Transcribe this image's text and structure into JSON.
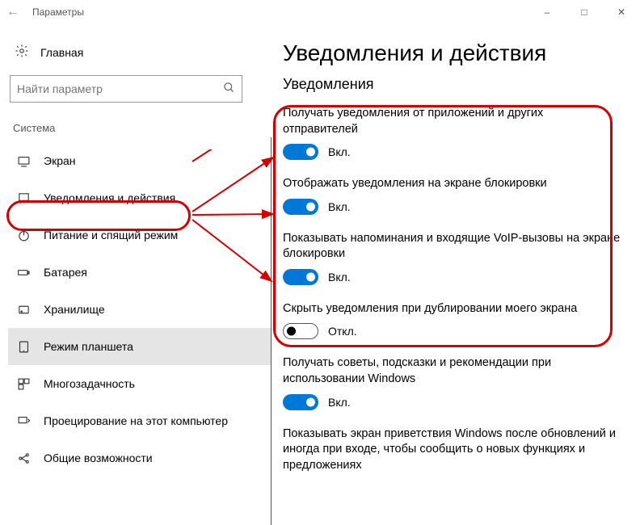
{
  "window": {
    "title": "Параметры"
  },
  "sidebar": {
    "home": "Главная",
    "search_placeholder": "Найти параметр",
    "section": "Система",
    "items": [
      {
        "label": "Экран"
      },
      {
        "label": "Уведомления и действия"
      },
      {
        "label": "Питание и спящий режим"
      },
      {
        "label": "Батарея"
      },
      {
        "label": "Хранилище"
      },
      {
        "label": "Режим планшета"
      },
      {
        "label": "Многозадачность"
      },
      {
        "label": "Проецирование на этот компьютер"
      },
      {
        "label": "Общие возможности"
      }
    ]
  },
  "page": {
    "heading": "Уведомления и действия",
    "section": "Уведомления",
    "toggles": [
      {
        "label": "Получать уведомления от приложений и других отправителей",
        "state": "Вкл.",
        "on": true
      },
      {
        "label": "Отображать уведомления на экране блокировки",
        "state": "Вкл.",
        "on": true
      },
      {
        "label": "Показывать напоминания и входящие VoIP-вызовы на экране блокировки",
        "state": "Вкл.",
        "on": true
      },
      {
        "label": "Скрыть уведомления при дублировании моего экрана",
        "state": "Откл.",
        "on": false
      },
      {
        "label": "Получать советы, подсказки и рекомендации при использовании Windows",
        "state": "Вкл.",
        "on": true
      },
      {
        "label": "Показывать экран приветствия Windows после обновлений и иногда при входе, чтобы сообщить о новых функциях и предложениях",
        "state": "",
        "on": true
      }
    ]
  }
}
